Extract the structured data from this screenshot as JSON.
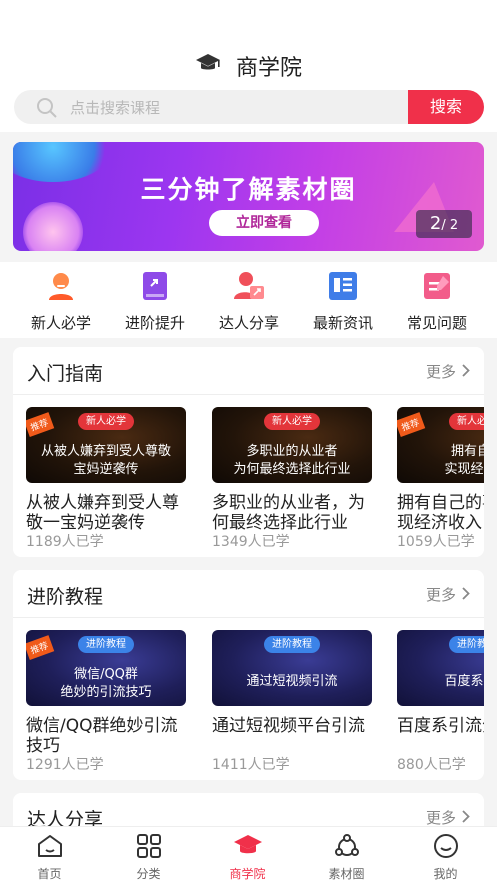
{
  "header": {
    "title": "商学院"
  },
  "search": {
    "placeholder": "点击搜索课程",
    "button": "搜索"
  },
  "banner": {
    "headline": "三分钟了解素材圈",
    "cta": "立即查看",
    "page_current": "2",
    "page_total": "/ 2"
  },
  "categories": [
    {
      "label": "新人必学",
      "icon": "newbie-icon"
    },
    {
      "label": "进阶提升",
      "icon": "advance-book-icon"
    },
    {
      "label": "达人分享",
      "icon": "expert-share-icon"
    },
    {
      "label": "最新资讯",
      "icon": "news-icon"
    },
    {
      "label": "常见问题",
      "icon": "faq-icon"
    }
  ],
  "sections": [
    {
      "title": "入门指南",
      "more": "更多",
      "courses": [
        {
          "ribbon": "推荐",
          "tag": "新人必学",
          "line1": "从被人嫌弃到受人尊敬",
          "line2": "宝妈逆袭传",
          "name": "从被人嫌弃到受人尊敬一宝妈逆袭传",
          "learners": "1189人已学"
        },
        {
          "ribbon": "",
          "tag": "新人必学",
          "line1": "多职业的从业者",
          "line2": "为何最终选择此行业",
          "name": "多职业的从业者，为何最终选择此行业",
          "learners": "1349人已学"
        },
        {
          "ribbon": "推荐",
          "tag": "新人必学",
          "line1": "拥有自己",
          "line2": "实现经济收",
          "name": "拥有自己的事业，实现经济收入",
          "learners": "1059人已学"
        }
      ]
    },
    {
      "title": "进阶教程",
      "more": "更多",
      "courses": [
        {
          "ribbon": "推荐",
          "tag": "进阶教程",
          "line1": "微信/QQ群",
          "line2": "绝妙的引流技巧",
          "name": "微信/QQ群绝妙引流技巧",
          "learners": "1291人已学"
        },
        {
          "ribbon": "",
          "tag": "进阶教程",
          "line1": "通过短视频引流",
          "line2": "",
          "name": "通过短视频平台引流",
          "learners": "1411人已学"
        },
        {
          "ribbon": "",
          "tag": "进阶教程",
          "line1": "百度系引流",
          "line2": "",
          "name": "百度系引流分享",
          "learners": "880人已学"
        }
      ]
    },
    {
      "title": "达人分享",
      "more": "更多"
    }
  ],
  "tabbar": [
    {
      "label": "首页",
      "icon": "home-icon",
      "active": false
    },
    {
      "label": "分类",
      "icon": "category-grid-icon",
      "active": false
    },
    {
      "label": "商学院",
      "icon": "graduation-cap-icon",
      "active": true
    },
    {
      "label": "素材圈",
      "icon": "material-circle-icon",
      "active": false
    },
    {
      "label": "我的",
      "icon": "profile-icon",
      "active": false
    }
  ],
  "colors": {
    "accent": "#f0304a",
    "tag_red": "#e3353a",
    "tag_blue": "#3b83e8"
  }
}
